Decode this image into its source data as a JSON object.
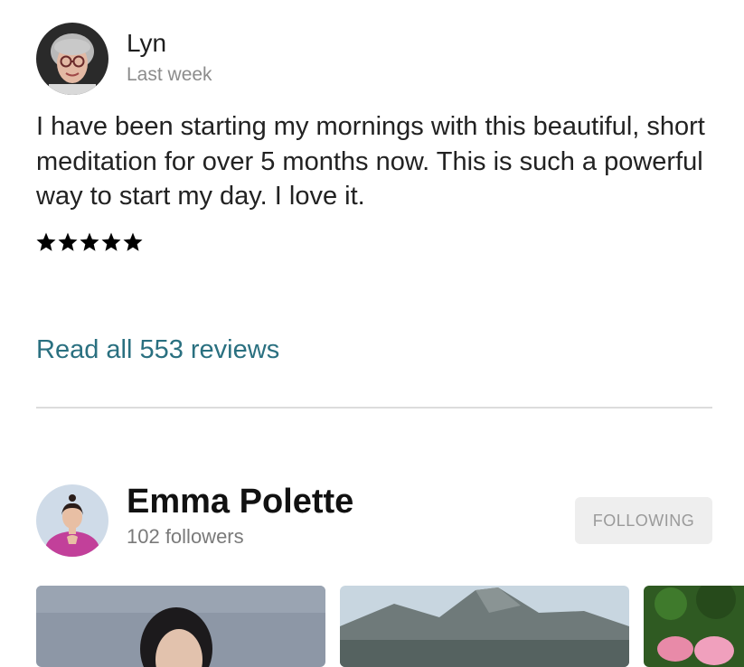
{
  "review": {
    "name": "Lyn",
    "time": "Last week",
    "text": "I have been starting my mornings with this beautiful, short meditation for over 5 months now. This is such a powerful way to start my day. I love it.",
    "rating": 5
  },
  "read_all_label": "Read all 553 reviews",
  "teacher": {
    "name": "Emma Polette",
    "followers": "102 followers",
    "follow_label": "FOLLOWING"
  },
  "colors": {
    "link": "#2a7080",
    "divider": "#dcdcdc",
    "button_bg": "#eeeeee",
    "button_text": "#9a9a9a"
  }
}
